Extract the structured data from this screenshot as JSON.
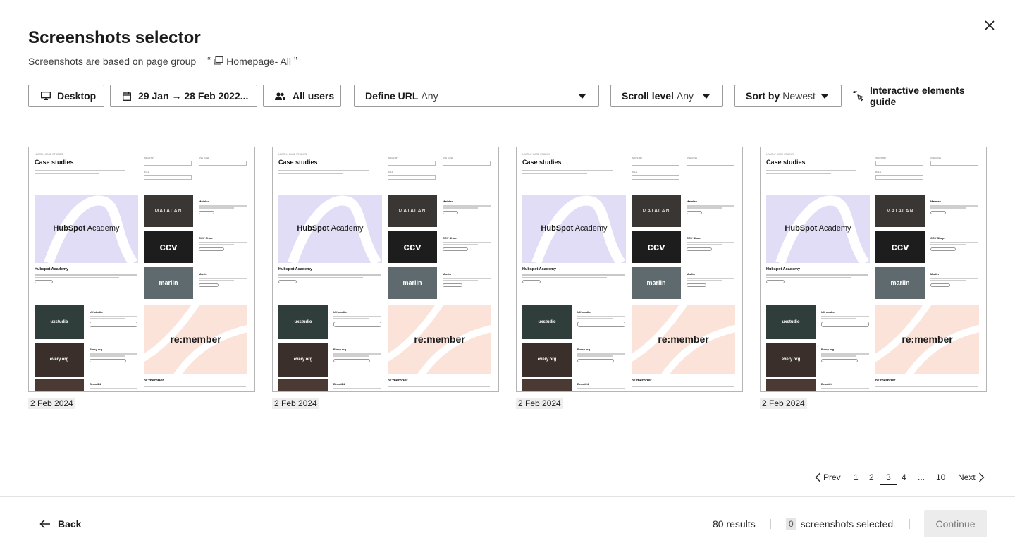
{
  "dialog": {
    "title": "Screenshots selector",
    "subtitle_prefix": "Screenshots are based on page group",
    "open_quote": "“",
    "close_quote": "”",
    "page_group": "Homepage- All"
  },
  "toolbar": {
    "device": "Desktop",
    "date_range": "29 Jan → 28 Feb 2022...",
    "users": "All users",
    "url_label": "Define URL",
    "url_value": "Any",
    "scroll_label": "Scroll level",
    "scroll_value": "Any",
    "sort_label": "Sort by",
    "sort_value": "Newest",
    "guide": "Interactive elements guide"
  },
  "thumbnail": {
    "breadcrumb": "LEARN / CASE STUDIES",
    "heading": "Case studies",
    "filter_labels": [
      "INDUSTRY",
      "USE CASE",
      "ROLE"
    ],
    "filter_value": "All",
    "hero_logo_bold": "HubSpot",
    "hero_logo_light": " Academy",
    "hero_title": "Hubspot Academy",
    "side_items": [
      {
        "name": "Matalan",
        "img_text": "MATALAN"
      },
      {
        "name": "CCV Shop",
        "img_text": "ccv"
      },
      {
        "name": "Marlin",
        "img_text": "marlin"
      }
    ],
    "small_items": [
      {
        "name": "UX studio",
        "img_text": "uxstudio"
      },
      {
        "name": "Every.org",
        "img_text": "every.org"
      },
      {
        "name": "Brand24",
        "img_text": ""
      }
    ],
    "big_logo": "re:member",
    "big_title": "re:member"
  },
  "screenshots": [
    {
      "date": "2 Feb 2024"
    },
    {
      "date": "2 Feb 2024"
    },
    {
      "date": "2 Feb 2024"
    },
    {
      "date": "2 Feb 2024"
    }
  ],
  "pagination": {
    "prev": "Prev",
    "next": "Next",
    "pages": [
      "1",
      "2",
      "3",
      "4",
      "...",
      "10"
    ],
    "current": "3"
  },
  "footer": {
    "back": "Back",
    "results": "80 results",
    "selected_count": "0",
    "selected_label": "screenshots selected",
    "continue": "Continue"
  },
  "colors": {
    "hero_bg": "#e2ddf6",
    "remember_bg": "#fbe3d9",
    "continue_bg": "#ececec"
  }
}
